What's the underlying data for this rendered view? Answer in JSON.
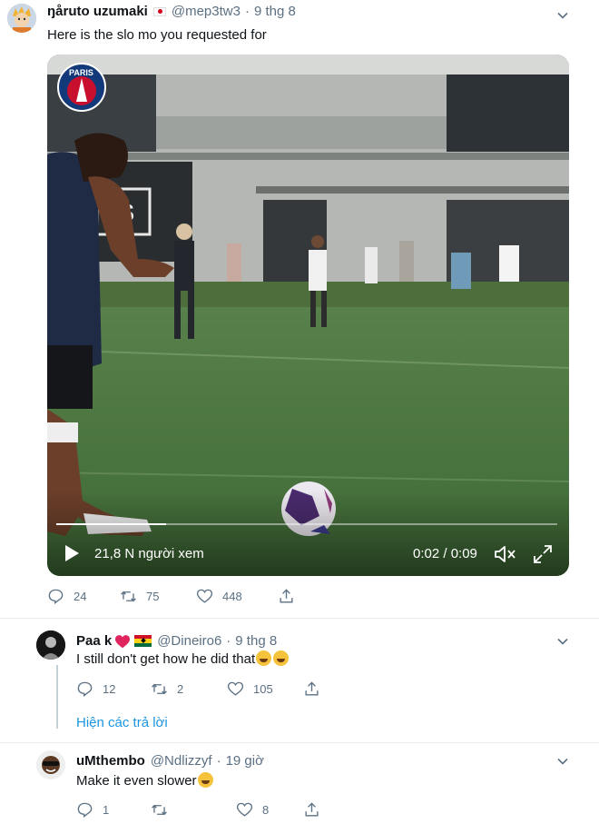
{
  "main_tweet": {
    "display_name": "ŋåruto uzumaki",
    "handle": "@mep3tw3",
    "separator": "·",
    "date": "9 thg 8",
    "text": "Here is the slo mo you requested for",
    "video": {
      "views_text": "21,8 N người xem",
      "time_text": "0:02 / 0:09",
      "progress_fraction": 0.22
    },
    "stats": {
      "replies": "24",
      "retweets": "75",
      "likes": "448"
    }
  },
  "replies": [
    {
      "display_name": "Paa k",
      "handle": "@Dineiro6",
      "separator": "·",
      "date": "9 thg 8",
      "text": "I still don't get how he did that",
      "stats": {
        "replies": "12",
        "retweets": "2",
        "likes": "105"
      }
    },
    {
      "display_name": "uMthembo",
      "handle": "@Ndlizzyf",
      "separator": "·",
      "date": "19 giờ",
      "text": "Make it even slower",
      "stats": {
        "replies": "1",
        "retweets": "",
        "likes": "8"
      }
    }
  ],
  "show_replies_label": "Hiện các trả lời",
  "colors": {
    "link": "#1b95e0",
    "muted": "#5b7083",
    "like_heart": "#e0245e"
  }
}
